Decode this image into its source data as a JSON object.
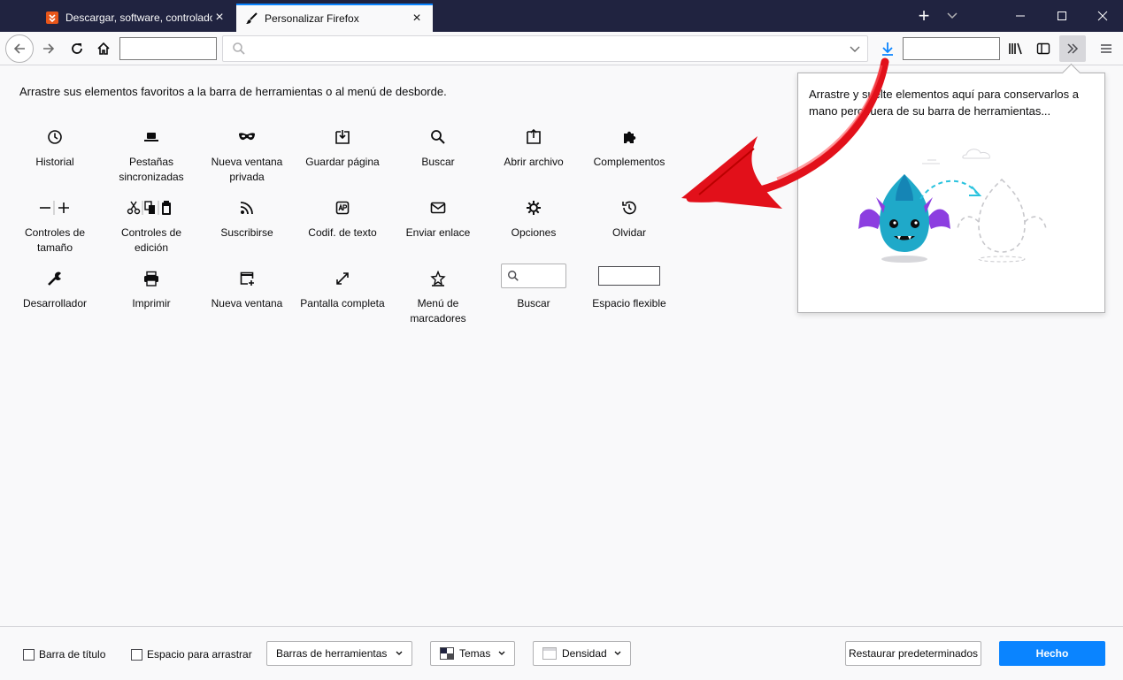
{
  "tabs": [
    {
      "title": "Descargar, software, controlado",
      "active": false
    },
    {
      "title": "Personalizar Firefox",
      "active": true
    }
  ],
  "palette": {
    "instruction": "Arrastre sus elementos favoritos a la barra de herramientas o al menú de desborde.",
    "items": [
      {
        "label": "Historial",
        "icon": "history-icon"
      },
      {
        "label": "Pestañas sincronizadas",
        "icon": "synced-tabs-icon"
      },
      {
        "label": "Nueva ventana privada",
        "icon": "private-window-icon"
      },
      {
        "label": "Guardar página",
        "icon": "save-page-icon"
      },
      {
        "label": "Buscar",
        "icon": "find-icon"
      },
      {
        "label": "Abrir archivo",
        "icon": "open-file-icon"
      },
      {
        "label": "Complementos",
        "icon": "addons-icon"
      },
      {
        "label": "Controles de tamaño",
        "icon": "zoom-controls-icon"
      },
      {
        "label": "Controles de edición",
        "icon": "edit-controls-icon"
      },
      {
        "label": "Suscribirse",
        "icon": "feed-icon"
      },
      {
        "label": "Codif. de texto",
        "icon": "text-encoding-icon"
      },
      {
        "label": "Enviar enlace",
        "icon": "email-link-icon"
      },
      {
        "label": "Opciones",
        "icon": "preferences-icon"
      },
      {
        "label": "Olvidar",
        "icon": "forget-icon"
      },
      {
        "label": "Desarrollador",
        "icon": "developer-icon"
      },
      {
        "label": "Imprimir",
        "icon": "print-icon"
      },
      {
        "label": "Nueva ventana",
        "icon": "new-window-icon"
      },
      {
        "label": "Pantalla completa",
        "icon": "fullscreen-icon"
      },
      {
        "label": "Menú de marcadores",
        "icon": "bookmarks-menu-icon"
      },
      {
        "label": "Buscar",
        "icon": "search-widget"
      },
      {
        "label": "Espacio flexible",
        "icon": "flexible-space"
      }
    ]
  },
  "overflow_panel": {
    "text": "Arrastre y suelte elementos aquí para conservarlos a mano pero fuera de su barra de herramientas..."
  },
  "footer": {
    "title_bar": "Barra de título",
    "drag_space": "Espacio para arrastrar",
    "toolbars": "Barras de herramientas",
    "themes": "Temas",
    "density": "Densidad",
    "restore": "Restaurar predeterminados",
    "done": "Hecho"
  },
  "colors": {
    "titlebar": "#202340",
    "accent": "#0a84ff",
    "arrow": "#e2101a"
  }
}
